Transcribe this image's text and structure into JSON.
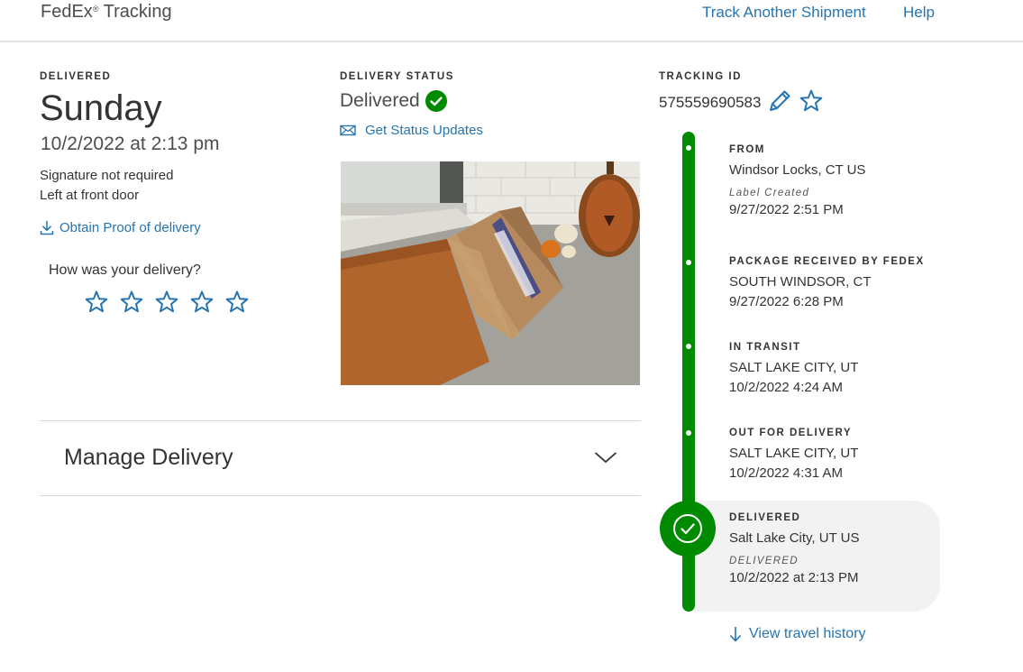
{
  "header": {
    "brand": "FedEx",
    "brand_mark": "®",
    "brand_suffix": " Tracking",
    "track_another": "Track Another Shipment",
    "help": "Help"
  },
  "summary": {
    "eyebrow": "DELIVERED",
    "day": "Sunday",
    "datetime": "10/2/2022 at 2:13 pm",
    "signature": "Signature not required",
    "left_at": "Left at front door",
    "proof_link": "Obtain Proof of delivery",
    "rating_prompt": "How was your delivery?",
    "rating_star_count": 5
  },
  "status": {
    "eyebrow": "DELIVERY STATUS",
    "value": "Delivered",
    "updates_link": "Get Status Updates"
  },
  "tracking": {
    "eyebrow": "TRACKING ID",
    "number": "575559690583"
  },
  "manage": {
    "label": "Manage Delivery"
  },
  "timeline": {
    "from": {
      "label": "FROM",
      "location": "Windsor Locks, CT US",
      "sub": "Label Created",
      "time": "9/27/2022 2:51 PM"
    },
    "received": {
      "label": "PACKAGE RECEIVED BY FEDEX",
      "location": "SOUTH WINDSOR, CT",
      "time": "9/27/2022 6:28 PM"
    },
    "transit": {
      "label": "IN TRANSIT",
      "location": "SALT LAKE CITY, UT",
      "time": "10/2/2022 4:24 AM"
    },
    "out": {
      "label": "OUT FOR DELIVERY",
      "location": "SALT LAKE CITY, UT",
      "time": "10/2/2022 4:31 AM"
    },
    "delivered": {
      "label": "DELIVERED",
      "location": "Salt Lake City, UT US",
      "sub": "DELIVERED",
      "time": "10/2/2022 at 2:13 PM"
    },
    "history_link": "View travel history"
  },
  "colors": {
    "link": "#2674b0",
    "success": "#008a00",
    "text": "#333333"
  },
  "icons": [
    "check-circle-icon",
    "envelope-icon",
    "download-icon",
    "star-outline-icon",
    "pencil-icon",
    "chevron-down-icon",
    "arrow-down-icon"
  ]
}
